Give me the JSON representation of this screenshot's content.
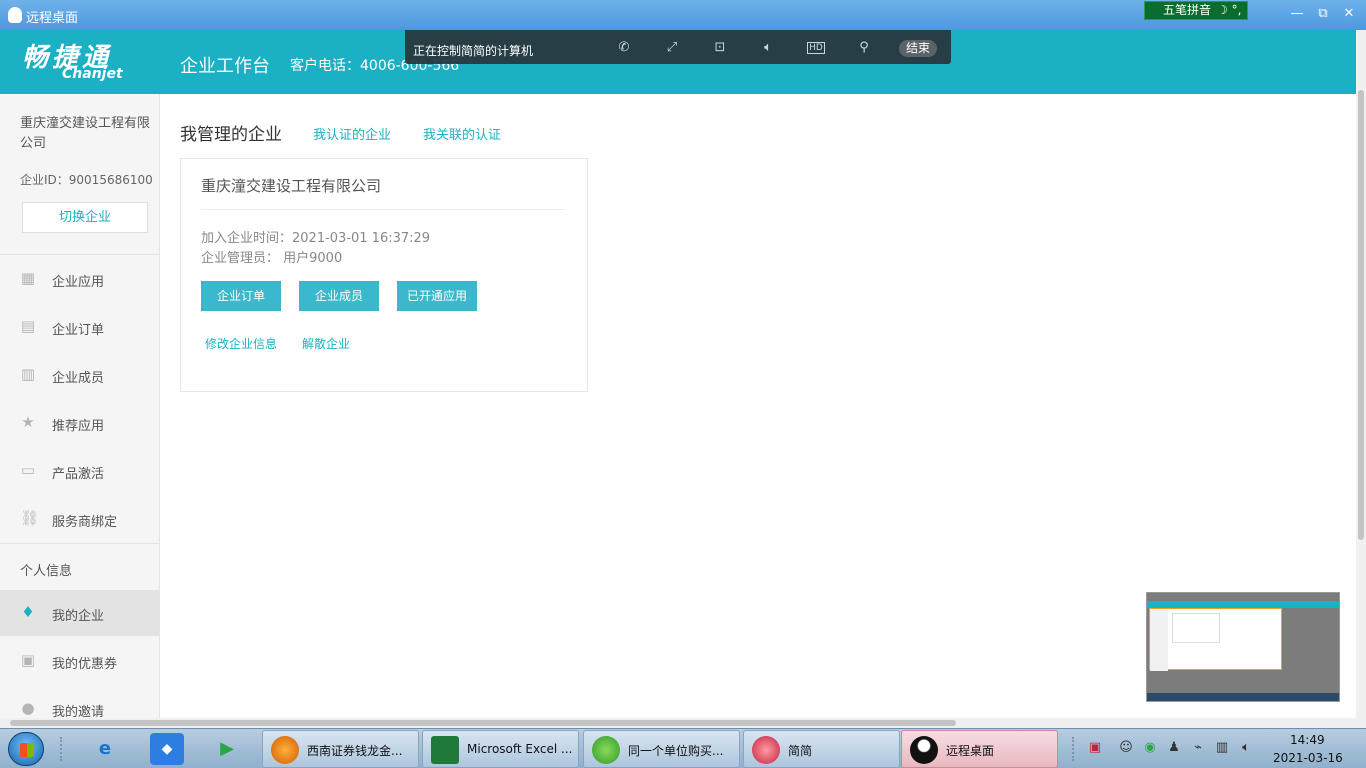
{
  "window": {
    "title": "远程桌面",
    "ime_label": "五笔拼音",
    "ime_extra": "☽ °,",
    "minimize": "—",
    "restore": "⧉",
    "close": "✕"
  },
  "header": {
    "logo_cn": "畅捷通",
    "logo_en": "Chanjet",
    "title": "企业工作台",
    "phone": "客户电话：4006-600-566"
  },
  "remote_toolbar": {
    "status": "正在控制简简的计算机",
    "icons": [
      "phone-icon",
      "fullscreen-icon",
      "screenshot-icon",
      "volume-icon",
      "hd-icon",
      "pin-icon"
    ],
    "end_label": "结束"
  },
  "sidebar": {
    "company_name": "重庆潼交建设工程有限公司",
    "company_id": "企业ID：90015686100",
    "switch_label": "切换企业",
    "items": [
      {
        "label": "企业应用",
        "icon": "apps-icon"
      },
      {
        "label": "企业订单",
        "icon": "order-icon"
      },
      {
        "label": "企业成员",
        "icon": "building-icon"
      },
      {
        "label": "推荐应用",
        "icon": "star-icon"
      },
      {
        "label": "产品激活",
        "icon": "ticket-icon"
      },
      {
        "label": "服务商绑定",
        "icon": "link-icon"
      }
    ],
    "section_label": "个人信息",
    "personal_items": [
      {
        "label": "我的企业",
        "icon": "tie-icon",
        "active": true
      },
      {
        "label": "我的优惠券",
        "icon": "coupon-icon"
      },
      {
        "label": "我的邀请",
        "icon": "user-icon"
      }
    ]
  },
  "main": {
    "tabs": {
      "active": "我管理的企业",
      "certified": "我认证的企业",
      "related": "我关联的认证"
    },
    "card": {
      "title": "重庆潼交建设工程有限公司",
      "join_time": "加入企业时间：2021-03-01 16:37:29",
      "admin": "企业管理员： 用户9000",
      "buttons": [
        "企业订单",
        "企业成员",
        "已开通应用"
      ],
      "links": [
        "修改企业信息",
        "解散企业"
      ]
    }
  },
  "taskbar": {
    "tasks": [
      {
        "label": "西南证券钱龙金..."
      },
      {
        "label": "Microsoft Excel ..."
      },
      {
        "label": "同一个单位购买..."
      },
      {
        "label": "简简"
      },
      {
        "label": "远程桌面",
        "active": true
      }
    ],
    "time": "14:49",
    "date": "2021-03-16"
  },
  "colors": {
    "brand": "#1cb0c5",
    "button": "#3bb8cb"
  }
}
